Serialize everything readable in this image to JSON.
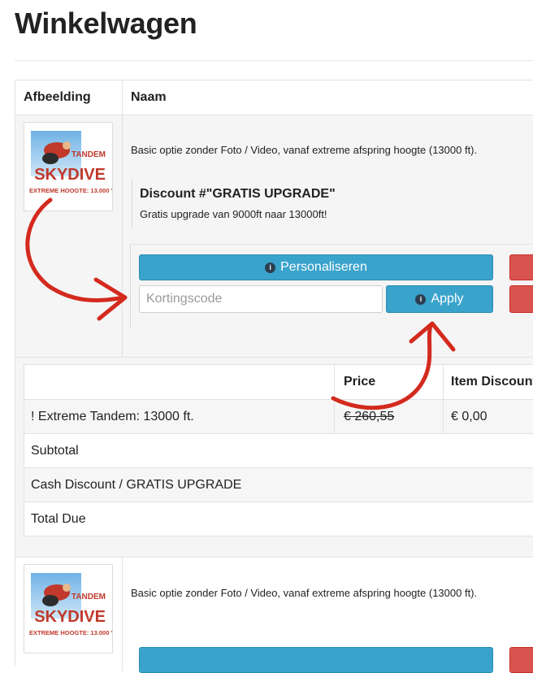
{
  "page": {
    "title": "Winkelwagen"
  },
  "table": {
    "headers": {
      "image": "Afbeelding",
      "name": "Naam"
    }
  },
  "item1": {
    "thumb": {
      "brand": "TANDEM",
      "title": "SKYDIVE",
      "caption": "EXTREME HOOGTE: 13.000 '"
    },
    "description": "Basic optie zonder Foto / Video, vanaf extreme afspring hoogte (13000 ft).",
    "discount": {
      "title": "Discount #\"GRATIS UPGRADE\"",
      "text": "Gratis upgrade van 9000ft naar 13000ft!"
    },
    "personalize_label": "Personaliseren",
    "coupon_placeholder": "Kortingscode",
    "apply_label": "Apply"
  },
  "pricing": {
    "headers": {
      "name": "",
      "price": "Price",
      "item_discount": "Item Discount"
    },
    "rows": [
      {
        "name": "! Extreme Tandem: 13000 ft.",
        "price": "€ 260,55",
        "item_discount": "€ 0,00"
      }
    ],
    "subtotal_label": "Subtotal",
    "cash_discount_label": "Cash Discount / GRATIS UPGRADE",
    "total_due_label": "Total Due"
  },
  "item2": {
    "thumb": {
      "brand": "TANDEM",
      "title": "SKYDIVE",
      "caption": "EXTREME HOOGTE: 13.000 '"
    },
    "description": "Basic optie zonder Foto / Video, vanaf extreme afspring hoogte (13000 ft)."
  },
  "colors": {
    "accent_blue": "#3aa3cc",
    "danger_red": "#d9534f",
    "annotation_red": "#d42a1e"
  },
  "icons": [
    "info-icon",
    "annotation-arrow"
  ]
}
